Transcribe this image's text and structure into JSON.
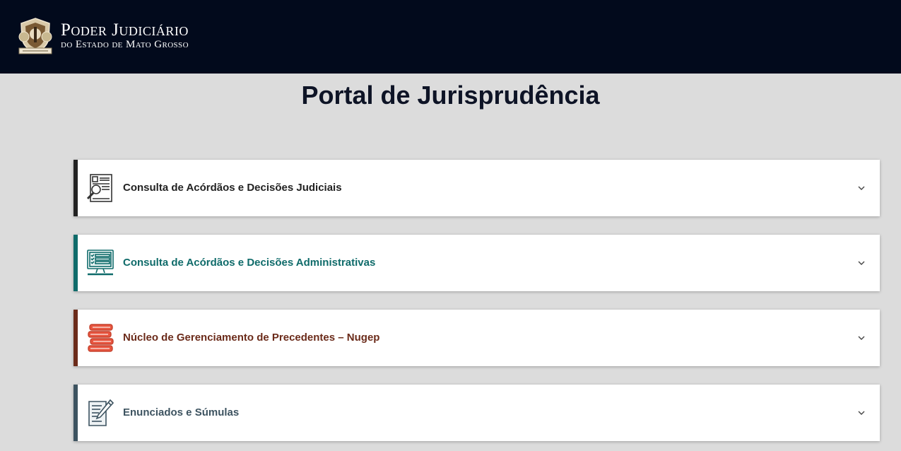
{
  "header": {
    "brand_title": "Poder Judiciário",
    "brand_subtitle": "do Estado de Mato Grosso",
    "logo_icon": "coat-of-arms-icon",
    "background": "#020a1c"
  },
  "page_title": "Portal de Jurisprudência",
  "sections": [
    {
      "label": "Consulta de Acórdãos e Decisões Judiciais",
      "icon": "document-search-icon",
      "color": "#222222"
    },
    {
      "label": "Consulta de Acórdãos e Decisões Administrativas",
      "icon": "computer-checklist-icon",
      "color": "#0f6b6a"
    },
    {
      "label": "Núcleo de Gerenciamento de Precedentes – Nugep",
      "icon": "book-stack-icon",
      "color": "#6b2b1a"
    },
    {
      "label": "Enunciados e Súmulas",
      "icon": "document-pen-icon",
      "color": "#3d5360"
    }
  ]
}
